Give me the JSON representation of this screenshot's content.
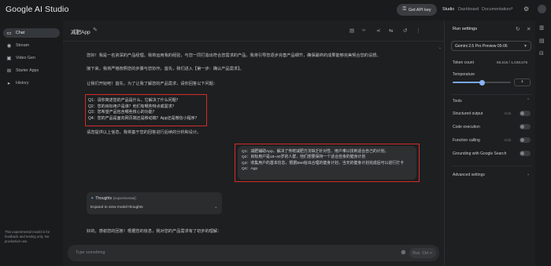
{
  "app": {
    "brand": "Google AI Studio"
  },
  "topbar": {
    "api_key_label": "Get API key",
    "links": [
      "Studio",
      "Dashboard",
      "Documentation"
    ]
  },
  "sidebar": {
    "items": [
      {
        "label": "Chat",
        "icon": "chat-icon",
        "active": true
      },
      {
        "label": "Stream",
        "icon": "stream-icon",
        "active": false
      },
      {
        "label": "Video Gen",
        "icon": "video-icon",
        "active": false
      },
      {
        "label": "Starter Apps",
        "icon": "apps-icon",
        "active": false
      },
      {
        "label": "History",
        "icon": "history-icon",
        "active": false
      }
    ],
    "footer_note": "This experimental model is for feedback and testing only. No production use."
  },
  "main": {
    "title": "减肥App",
    "messages": {
      "intro_1": "您好！我是一名资深的产品经理。我将运用我的经验，与您一同打造出符合您需求的产品。我将引导您逐步完善产品细节，确保最终的成果能够完美契合您的设想。",
      "intro_2": "接下来，我将严格按照您的步骤与您协作。首先，我们进入【第一步：确认产品需求】。",
      "intro_3": "让我们开始吧！首先，为了让我了解您的产品需求，请你回答以下问题：",
      "questions": [
        "Q1：请你简述您的产品是什么，它解决了什么问题？",
        "Q2：您的目标用户是谁？他们有哪些特点或需求？",
        "Q3：您希望产品包含哪些核心的功能？",
        "Q4：您的产品是面向网页端还是移动端？App还是微信小程序？"
      ],
      "outro": "请您提供以上信息，我将基于您的回答进行后续的分析和设计。",
      "user_answers": [
        "Q1：减肥辅助App。解决了传统减肥方法缺乏针对性、用户难以找到适合自己的计划。",
        "Q2：目标用户是18~40岁的人群，他们想要保持一个适合自身的健身计划",
        "Q3：收集用户的基本信息，根据BMI给出合理的健身计划，当天的健身计划完成后可以进行打卡",
        "Q4：App"
      ],
      "reply_start": "好的。感谢您的回答！根据您的信息，我对您的产品需求有了初步的理解："
    },
    "thoughts": {
      "header": "Thoughts",
      "tag": "(experimental)",
      "expand_label": "Expand to view model thoughts"
    },
    "prompt": {
      "placeholder": "Type something",
      "run_label": "Run",
      "run_shortcut": "Ctrl ↵"
    }
  },
  "run_settings": {
    "title": "Run settings",
    "model": "Gemini 2.5 Pro Preview 05-06",
    "token_count_label": "Token count",
    "token_count_value": "85,516 / 1,048,576",
    "temperature_label": "Temperature",
    "temperature_value": "1",
    "temperature_fraction": 0.5,
    "tools_label": "Tools",
    "tools": [
      {
        "label": "Structured output",
        "edit": "Edit"
      },
      {
        "label": "Code execution",
        "edit": ""
      },
      {
        "label": "Function calling",
        "edit": "Edit"
      },
      {
        "label": "Grounding with Google Search",
        "edit": ""
      }
    ],
    "advanced_label": "Advanced settings"
  },
  "colors": {
    "accent": "#8ab4f8",
    "highlight_border": "#d42b2b",
    "background": "#1e1f20"
  }
}
